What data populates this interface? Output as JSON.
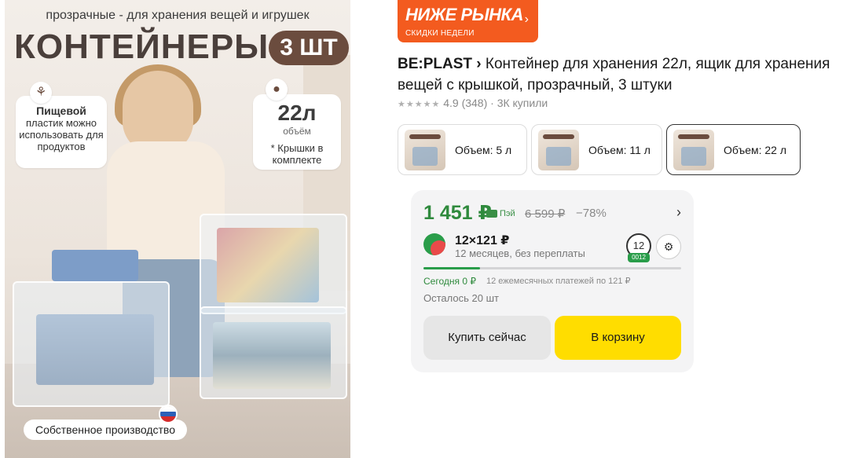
{
  "hero": {
    "subtitle": "прозрачные - для хранения вещей и игрушек",
    "title": "КОНТЕЙНЕРЫ",
    "pill": "3 ШТ",
    "badge_food_lead": "Пищевой",
    "badge_food_rest": "пластик можно использовать для продуктов",
    "badge_volume_big": "22л",
    "badge_volume_unit": "объём",
    "badge_volume_note": "* Крышки в комплекте",
    "made_in": "Собственное производство",
    "icons": [
      "wheat-icon",
      "drop-icon",
      "russia-flag-icon"
    ]
  },
  "promo": {
    "title": "НИЖЕ РЫНКА",
    "subtitle": "СКИДКИ НЕДЕЛИ"
  },
  "product": {
    "brand": "BE:PLAST",
    "brand_chevron": "›",
    "title": "Контейнер для хранения 22л, ящик для хране­ния вещей с крышкой, прозрачный, 3 штуки",
    "stars": "★★★★★",
    "rating": "4.9",
    "reviews": "(348)",
    "bought": "· 3К купили"
  },
  "variants": [
    {
      "label": "Объем: 5 л",
      "selected": false
    },
    {
      "label": "Объем: 11 л",
      "selected": false
    },
    {
      "label": "Объем: 22 л",
      "selected": true
    }
  ],
  "price_card": {
    "price": "1 451 ₽",
    "pay_label": "Пэй",
    "old_price": "6 599 ₽",
    "discount": "−78%",
    "split_main": "12×121 ₽",
    "split_sub": "12 месяцев, без переплаты",
    "months_badge": "12",
    "months_tag": "0012",
    "progress_fraction": 0.22,
    "today": "Сегодня 0 ₽",
    "monthly": "12 ежемесячных платежей по 121 ₽",
    "stock": "Осталось 20 шт",
    "buy_now": "Купить сейчас",
    "add_to_cart": "В корзину"
  },
  "colors": {
    "promo": "#f35b1f",
    "price_green": "#2f8a3d",
    "cart_yellow": "#ffdd00"
  }
}
